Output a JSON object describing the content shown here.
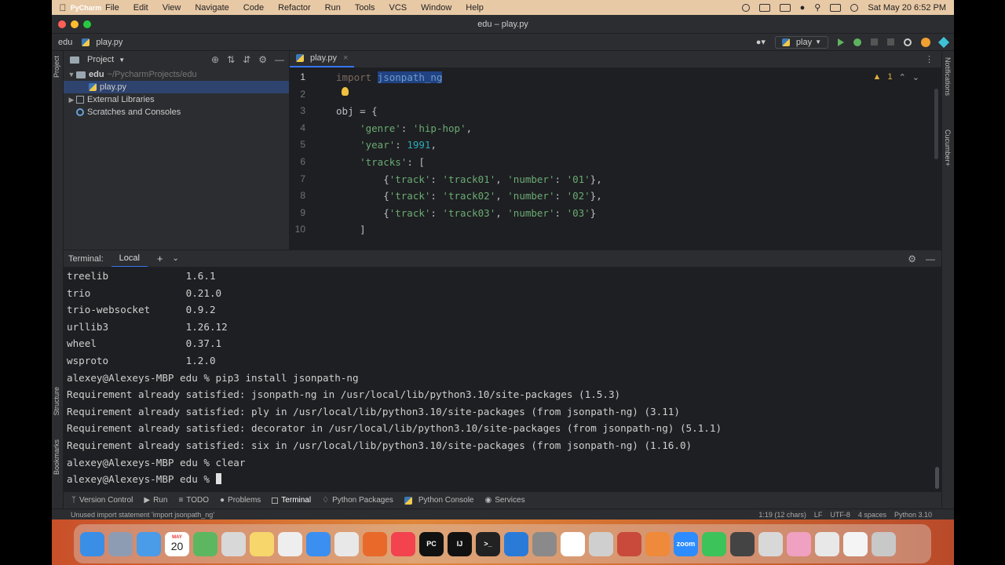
{
  "menubar": {
    "app": "PyCharm",
    "items": [
      "File",
      "Edit",
      "View",
      "Navigate",
      "Code",
      "Refactor",
      "Run",
      "Tools",
      "VCS",
      "Window",
      "Help"
    ],
    "clock": "Sat May 20  6:52 PM"
  },
  "window": {
    "title": "edu – play.py"
  },
  "navbar": {
    "project": "edu",
    "file": "play.py",
    "run_config": "play"
  },
  "project_panel": {
    "title": "Project",
    "tree": [
      {
        "label": "edu",
        "path": "~/PycharmProjects/edu"
      },
      {
        "label": "play.py"
      },
      {
        "label": "External Libraries"
      },
      {
        "label": "Scratches and Consoles"
      }
    ]
  },
  "editor": {
    "tab": "play.py",
    "warnings": "1",
    "line_numbers": [
      "1",
      "2",
      "3",
      "4",
      "5",
      "6",
      "7",
      "8",
      "9",
      "10"
    ],
    "code": {
      "l1_kw": "import",
      "l1_mod": "jsonpath_ng",
      "l3": "obj = {",
      "l4_key": "'genre'",
      "l4_val": "'hip-hop'",
      "l5_key": "'year'",
      "l5_val": "1991",
      "l6_key": "'tracks'",
      "l7": [
        "'track'",
        "'track01'",
        "'number'",
        "'01'"
      ],
      "l8": [
        "'track'",
        "'track02'",
        "'number'",
        "'02'"
      ],
      "l9": [
        "'track'",
        "'track03'",
        "'number'",
        "'03'"
      ],
      "l10": "]"
    }
  },
  "terminal": {
    "label": "Terminal:",
    "tab": "Local",
    "lines": [
      "treelib             1.6.1",
      "trio                0.21.0",
      "trio-websocket      0.9.2",
      "urllib3             1.26.12",
      "wheel               0.37.1",
      "wsproto             1.2.0",
      "alexey@Alexeys-MBP edu % pip3 install jsonpath-ng",
      "Requirement already satisfied: jsonpath-ng in /usr/local/lib/python3.10/site-packages (1.5.3)",
      "Requirement already satisfied: ply in /usr/local/lib/python3.10/site-packages (from jsonpath-ng) (3.11)",
      "Requirement already satisfied: decorator in /usr/local/lib/python3.10/site-packages (from jsonpath-ng) (5.1.1)",
      "Requirement already satisfied: six in /usr/local/lib/python3.10/site-packages (from jsonpath-ng) (1.16.0)",
      "alexey@Alexeys-MBP edu % clear"
    ],
    "prompt": "alexey@Alexeys-MBP edu % "
  },
  "bottom_tools": [
    "Version Control",
    "Run",
    "TODO",
    "Problems",
    "Terminal",
    "Python Packages",
    "Python Console",
    "Services"
  ],
  "side_labels": {
    "project": "Project",
    "structure": "Structure",
    "bookmarks": "Bookmarks",
    "notifications": "Notifications",
    "cucumber": "Cucumber+"
  },
  "statusbar": {
    "message": "Unused import statement 'import jsonpath_ng'",
    "position": "1:19 (12 chars)",
    "line_sep": "LF",
    "encoding": "UTF-8",
    "indent": "4 spaces",
    "interpreter": "Python 3.10"
  },
  "dock": {
    "calendar_month": "MAY",
    "calendar_day": "20",
    "apps": [
      {
        "name": "finder-icon",
        "color": "#3a8ee6",
        "text": ""
      },
      {
        "name": "launchpad-icon",
        "color": "#8e9cb3",
        "text": ""
      },
      {
        "name": "mail-icon",
        "color": "#4a9be8",
        "text": ""
      },
      {
        "name": "calendar-icon",
        "color": "#ffffff",
        "text": ""
      },
      {
        "name": "maps-icon",
        "color": "#5db760",
        "text": ""
      },
      {
        "name": "security-icon",
        "color": "#d8d8d8",
        "text": ""
      },
      {
        "name": "notes-icon",
        "color": "#f7d76b",
        "text": ""
      },
      {
        "name": "textedit-icon",
        "color": "#eeeeee",
        "text": ""
      },
      {
        "name": "safari-icon",
        "color": "#3b8ff0",
        "text": ""
      },
      {
        "name": "chrome-icon",
        "color": "#e8e8e8",
        "text": ""
      },
      {
        "name": "firefox-icon",
        "color": "#e8692a",
        "text": ""
      },
      {
        "name": "music-icon",
        "color": "#f2434f",
        "text": ""
      },
      {
        "name": "pycharm-icon",
        "color": "#111111",
        "text": "PC"
      },
      {
        "name": "intellij-icon",
        "color": "#111111",
        "text": "IJ"
      },
      {
        "name": "terminal-icon",
        "color": "#222222",
        "text": ">_"
      },
      {
        "name": "vscode-icon",
        "color": "#2a7bd8",
        "text": ""
      },
      {
        "name": "settings-icon",
        "color": "#8a8a8a",
        "text": ""
      },
      {
        "name": "slack-icon",
        "color": "#ffffff",
        "text": ""
      },
      {
        "name": "toolbox-icon",
        "color": "#cfcfcf",
        "text": ""
      },
      {
        "name": "database-icon",
        "color": "#c94a3a",
        "text": ""
      },
      {
        "name": "pen-icon",
        "color": "#ef8a3a",
        "text": ""
      },
      {
        "name": "zoom-icon",
        "color": "#2d8cff",
        "text": "zoom"
      },
      {
        "name": "facetime-icon",
        "color": "#3cc35a",
        "text": ""
      },
      {
        "name": "quicktime-icon",
        "color": "#444444",
        "text": ""
      },
      {
        "name": "preview-icon",
        "color": "#d8d8d8",
        "text": ""
      },
      {
        "name": "photos-icon",
        "color": "#f0a0c0",
        "text": ""
      },
      {
        "name": "window-icon",
        "color": "#e8e8e8",
        "text": ""
      },
      {
        "name": "window2-icon",
        "color": "#f4f4f4",
        "text": ""
      },
      {
        "name": "trash-icon",
        "color": "#c8c8c8",
        "text": ""
      }
    ]
  }
}
